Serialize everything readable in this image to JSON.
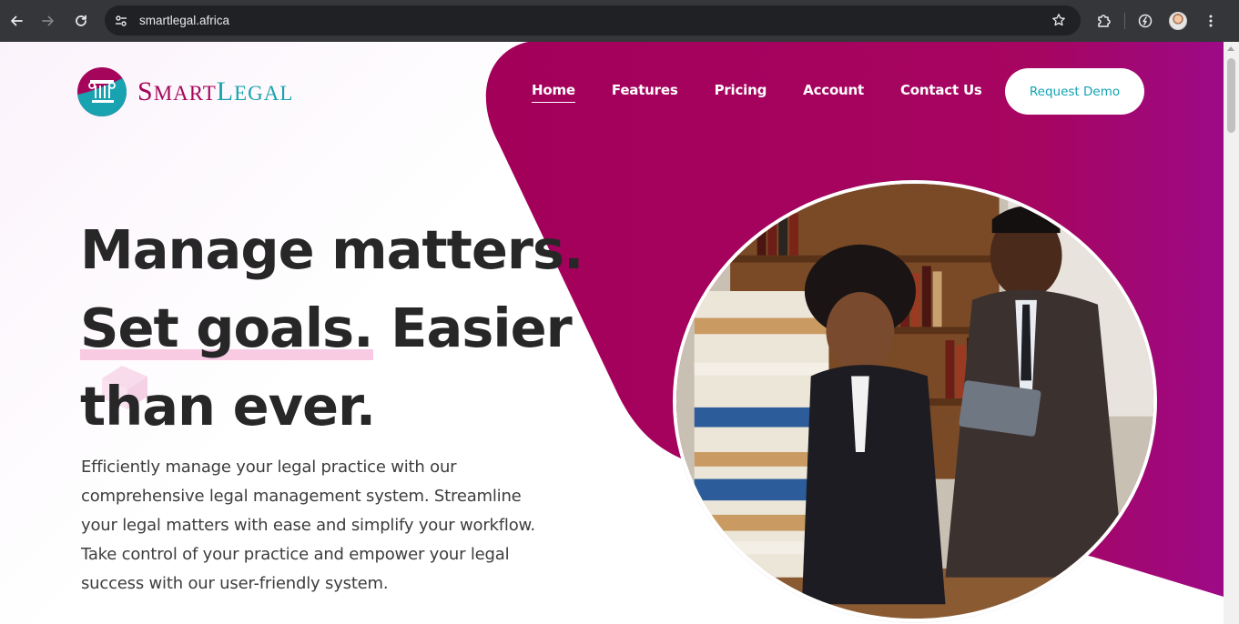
{
  "browser": {
    "url": "smartlegal.africa",
    "icons": {
      "back": "arrow-left-icon",
      "forward": "arrow-right-icon",
      "reload": "reload-icon",
      "site_info": "tune-icon",
      "bookmark": "star-icon",
      "extensions": "puzzle-icon",
      "performance": "speed-icon",
      "menu": "kebab-menu-icon"
    }
  },
  "brand": {
    "name_first_big": "S",
    "name_first_rest": "MART",
    "name_second_big": "L",
    "name_second_rest": "EGAL",
    "colors": {
      "primary": "#a5065c",
      "accent": "#19a3b0"
    }
  },
  "nav": {
    "items": [
      {
        "label": "Home",
        "active": true
      },
      {
        "label": "Features",
        "active": false
      },
      {
        "label": "Pricing",
        "active": false
      },
      {
        "label": "Account",
        "active": false
      },
      {
        "label": "Contact Us",
        "active": false
      }
    ],
    "cta": "Request Demo"
  },
  "hero": {
    "line1": "Manage matters.",
    "line2_highlight": "Set goals.",
    "line2_rest": " Easier",
    "line3": "than ever.",
    "description": "Efficiently manage your legal practice with our comprehensive legal management system. Streamline your legal matters with ease and simplify your workflow. Take control of your practice and empower your legal success with our user-friendly system."
  },
  "colors": {
    "magenta": "#a5005c",
    "magenta_light": "#b30a7a",
    "heading": "#272727",
    "body_text": "#3d3d3d",
    "highlight": "#f9cbe3"
  }
}
